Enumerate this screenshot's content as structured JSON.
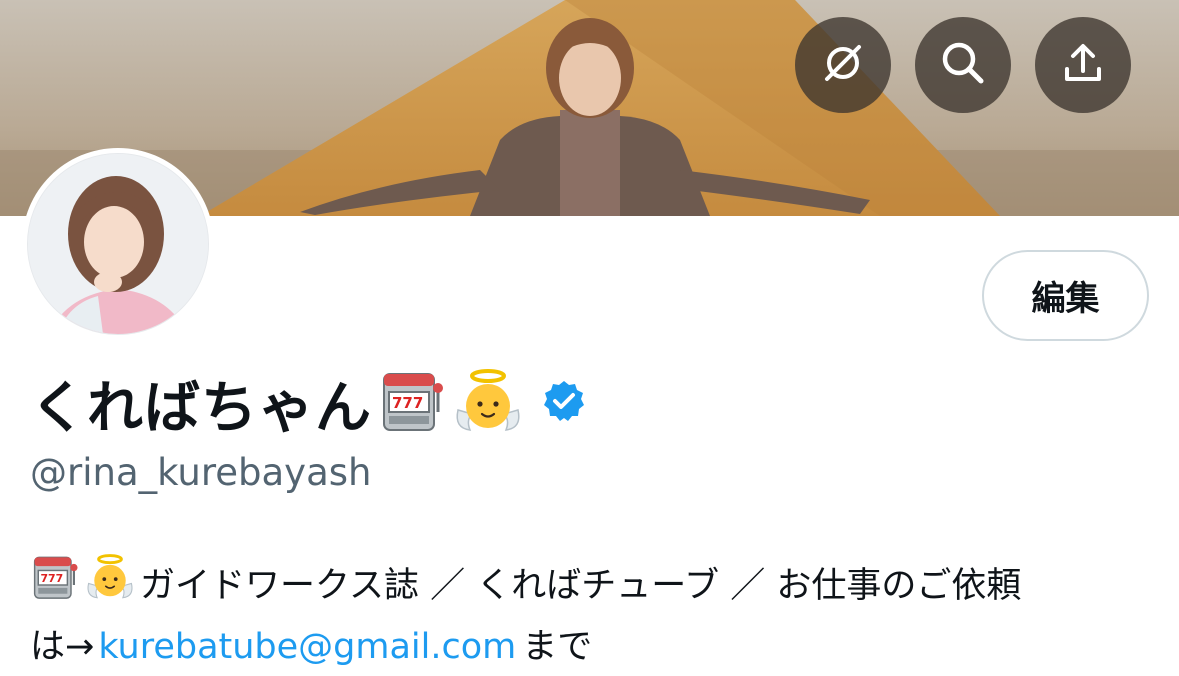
{
  "header": {
    "sync_icon": "sync-off-icon",
    "search_icon": "search-icon",
    "share_icon": "share-icon"
  },
  "profile": {
    "display_name": "くればちゃん",
    "name_emojis": [
      "slot-machine-icon",
      "baby-angel-icon"
    ],
    "verified": true,
    "handle": "@rina_kurebayash",
    "edit_label": "編集"
  },
  "bio": {
    "emojis": [
      "slot-machine-icon",
      "baby-angel-icon"
    ],
    "line1_text": "ガイドワークス誌 ／ くればチューブ ／ お仕事のご依頼",
    "line2_prefix": "は→",
    "email": "kurebatube@gmail.com",
    "line2_suffix": "まで"
  },
  "colors": {
    "accent": "#1d9bf0",
    "secondary_text": "#536471",
    "border": "#cfd9de",
    "verified_badge": "#1d9bf0"
  }
}
